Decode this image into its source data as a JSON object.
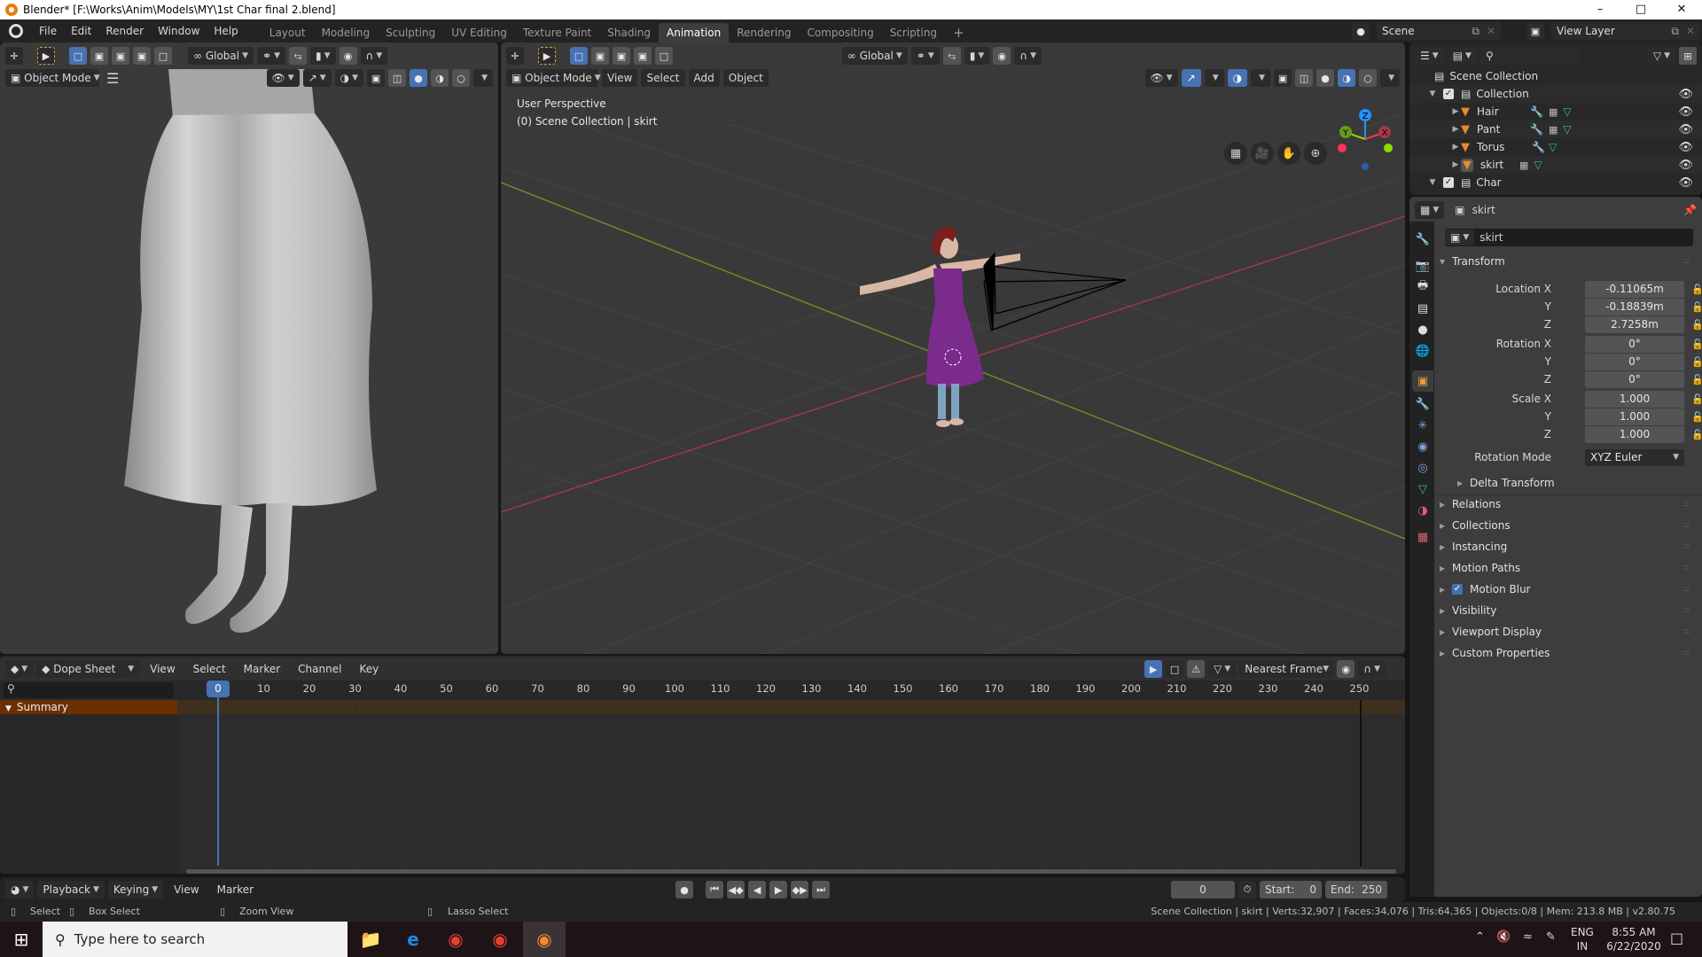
{
  "window": {
    "title": "Blender* [F:\\Works\\Anim\\Models\\MY\\1st Char final 2.blend]",
    "controls": {
      "minimize": "–",
      "maximize": "□",
      "close": "✕"
    }
  },
  "menubar": {
    "menus": [
      "File",
      "Edit",
      "Render",
      "Window",
      "Help"
    ],
    "workspaces": [
      "Layout",
      "Modeling",
      "Sculpting",
      "UV Editing",
      "Texture Paint",
      "Shading",
      "Animation",
      "Rendering",
      "Compositing",
      "Scripting"
    ],
    "active_workspace": "Animation",
    "add_workspace": "+",
    "scene": "Scene",
    "view_layer": "View Layer"
  },
  "left_viewport": {
    "transform_orientation": "Global",
    "mode": "Object Mode",
    "menu_icon": "☰"
  },
  "main_viewport": {
    "transform_orientation": "Global",
    "mode": "Object Mode",
    "menus": [
      "View",
      "Select",
      "Add",
      "Object"
    ],
    "perspective_label": "User Perspective",
    "collection_label": "(0) Scene Collection | skirt",
    "gizmo_axes": {
      "z": "Z",
      "y": "Y",
      "x": "X"
    },
    "axis_colors": {
      "x": "#ff3352",
      "y": "#8bdc00",
      "z": "#2890ff"
    }
  },
  "outliner": {
    "search_placeholder": "",
    "root": "Scene Collection",
    "items": [
      {
        "name": "Collection",
        "type": "collection",
        "checked": true
      },
      {
        "name": "Hair",
        "type": "mesh"
      },
      {
        "name": "Pant",
        "type": "mesh"
      },
      {
        "name": "Torus",
        "type": "mesh"
      },
      {
        "name": "skirt",
        "type": "mesh",
        "selected": true
      },
      {
        "name": "Char",
        "type": "collection",
        "checked": true
      }
    ]
  },
  "properties": {
    "context_object": "skirt",
    "object_name": "skirt",
    "transform": {
      "title": "Transform",
      "location": {
        "label": "Location X",
        "x": "-0.11065m",
        "y": "-0.18839m",
        "z": "2.7258m"
      },
      "rotation": {
        "label": "Rotation X",
        "x": "0°",
        "y": "0°",
        "z": "0°"
      },
      "scale": {
        "label": "Scale X",
        "x": "1.000",
        "y": "1.000",
        "z": "1.000"
      },
      "axis_y": "Y",
      "axis_z": "Z",
      "rotation_mode_label": "Rotation Mode",
      "rotation_mode": "XYZ Euler",
      "delta_transform": "Delta Transform"
    },
    "panels": [
      "Relations",
      "Collections",
      "Instancing",
      "Motion Paths",
      "Motion Blur",
      "Visibility",
      "Viewport Display",
      "Custom Properties"
    ],
    "motion_blur_checked": true
  },
  "dopesheet": {
    "editor_mode": "Dope Sheet",
    "menus": [
      "View",
      "Select",
      "Marker",
      "Channel",
      "Key"
    ],
    "snap_mode": "Nearest Frame",
    "current_frame_marker": "0",
    "frame_ticks": [
      "10",
      "20",
      "30",
      "40",
      "50",
      "60",
      "70",
      "80",
      "90",
      "100",
      "110",
      "120",
      "130",
      "140",
      "150",
      "160",
      "170",
      "180",
      "190",
      "200",
      "210",
      "220",
      "230",
      "240",
      "250"
    ],
    "summary_label": "Summary"
  },
  "timeline": {
    "menus": [
      "Playback",
      "Keying",
      "View",
      "Marker"
    ],
    "current_frame": "0",
    "start_label": "Start:",
    "start": "0",
    "end_label": "End:",
    "end": "250"
  },
  "statusbar": {
    "hints": [
      "Select",
      "Box Select",
      "Zoom View",
      "Lasso Select"
    ],
    "info": "Scene Collection | skirt | Verts:32,907 | Faces:34,076 | Tris:64,365 | Objects:0/8 | Mem: 213.8 MB | v2.80.75"
  },
  "taskbar": {
    "search_placeholder": "Type here to search",
    "language": "ENG",
    "region": "IN",
    "time": "8:55 AM",
    "date": "6/22/2020"
  }
}
